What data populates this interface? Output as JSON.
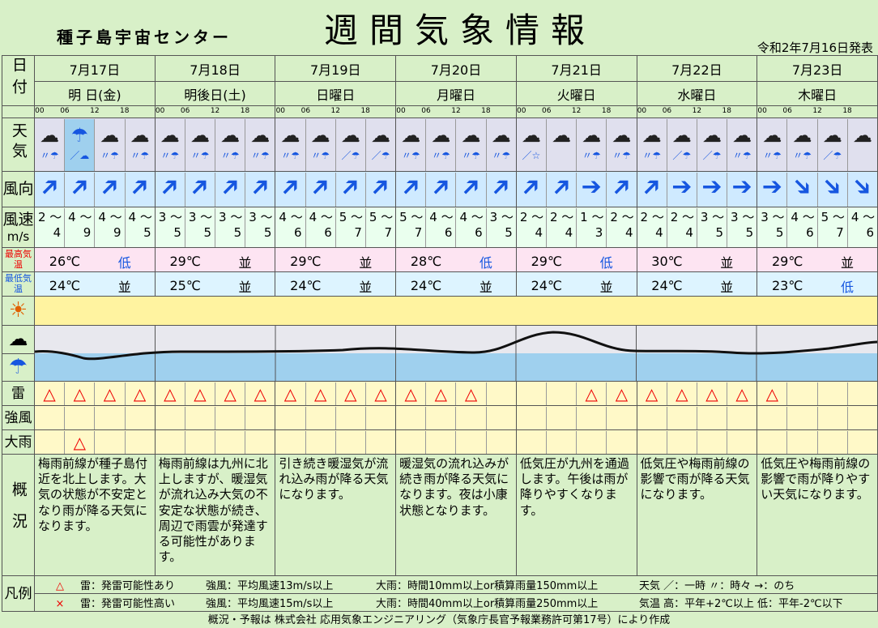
{
  "header": {
    "center": "種子島宇宙センター",
    "title": "週間気象情報",
    "issued": "令和2年7月16日発表"
  },
  "row_labels": {
    "date": "日付",
    "weather": "天気",
    "wind_dir": "風向",
    "wind_speed": "風速",
    "wind_unit": "m/s",
    "tmax": "最高気温",
    "tmin": "最低気温",
    "thunder": "雷",
    "strong_wind": "強風",
    "heavy_rain": "大雨",
    "summary": "概況",
    "legend": "凡例"
  },
  "ticks": [
    "00",
    "06",
    "12",
    "18"
  ],
  "days": [
    {
      "date": "7月17日",
      "dow": "明 日(金)",
      "weather": [
        "cloud",
        "umbrella",
        "cloud",
        "cloud"
      ],
      "sub": [
        "〃☂",
        "／☁",
        "〃☂",
        "〃☂"
      ],
      "dirs": [
        "NE",
        "NE",
        "NE",
        "NE"
      ],
      "speeds": [
        [
          "2",
          "4"
        ],
        [
          "4",
          "9"
        ],
        [
          "4",
          "9"
        ],
        [
          "4",
          "5"
        ]
      ],
      "tmax": "26℃",
      "tmax_r": "低",
      "tmin": "24℃",
      "tmin_r": "並",
      "thunder": [
        "△",
        "△",
        "△",
        "△"
      ],
      "strong": [
        "",
        "",
        "",
        ""
      ],
      "heavy": [
        "",
        "△",
        "",
        ""
      ],
      "summary": "梅雨前線が種子島付近を北上します。大気の状態が不安定となり雨が降る天気になります。"
    },
    {
      "date": "7月18日",
      "dow": "明後日(土)",
      "weather": [
        "cloud",
        "cloud",
        "cloud",
        "cloud"
      ],
      "sub": [
        "〃☂",
        "〃☂",
        "〃☂",
        "〃☂"
      ],
      "dirs": [
        "NE",
        "NE",
        "NE",
        "NE"
      ],
      "speeds": [
        [
          "3",
          "5"
        ],
        [
          "3",
          "5"
        ],
        [
          "3",
          "5"
        ],
        [
          "3",
          "5"
        ]
      ],
      "tmax": "29℃",
      "tmax_r": "並",
      "tmin": "25℃",
      "tmin_r": "並",
      "thunder": [
        "△",
        "△",
        "△",
        "△"
      ],
      "strong": [
        "",
        "",
        "",
        ""
      ],
      "heavy": [
        "",
        "",
        "",
        ""
      ],
      "summary": "梅雨前線は九州に北上しますが、暖湿気が流れ込み大気の不安定な状態が続き、周辺で雨雲が発達する可能性があります。"
    },
    {
      "date": "7月19日",
      "dow": "日曜日",
      "weather": [
        "cloud",
        "cloud",
        "cloud",
        "cloud"
      ],
      "sub": [
        "〃☂",
        "〃☂",
        "／☂",
        "／☂"
      ],
      "dirs": [
        "NE",
        "NE",
        "NE",
        "NE"
      ],
      "speeds": [
        [
          "4",
          "6"
        ],
        [
          "4",
          "6"
        ],
        [
          "5",
          "7"
        ],
        [
          "5",
          "7"
        ]
      ],
      "tmax": "29℃",
      "tmax_r": "並",
      "tmin": "24℃",
      "tmin_r": "並",
      "thunder": [
        "△",
        "△",
        "△",
        "△"
      ],
      "strong": [
        "",
        "",
        "",
        ""
      ],
      "heavy": [
        "",
        "",
        "",
        ""
      ],
      "summary": "引き続き暖湿気が流れ込み雨が降る天気になります。"
    },
    {
      "date": "7月20日",
      "dow": "月曜日",
      "weather": [
        "cloud",
        "cloud",
        "cloud",
        "cloud"
      ],
      "sub": [
        "〃☂",
        "〃☂",
        "〃☂",
        "〃☂"
      ],
      "dirs": [
        "NE",
        "NE",
        "NE",
        "NE"
      ],
      "speeds": [
        [
          "5",
          "7"
        ],
        [
          "4",
          "6"
        ],
        [
          "4",
          "6"
        ],
        [
          "3",
          "5"
        ]
      ],
      "tmax": "28℃",
      "tmax_r": "低",
      "tmin": "24℃",
      "tmin_r": "並",
      "thunder": [
        "△",
        "△",
        "△",
        ""
      ],
      "strong": [
        "",
        "",
        "",
        ""
      ],
      "heavy": [
        "",
        "",
        "",
        ""
      ],
      "summary": "暖湿気の流れ込みが続き雨が降る天気になります。夜は小康状態となります。"
    },
    {
      "date": "7月21日",
      "dow": "火曜日",
      "weather": [
        "cloud",
        "cloud",
        "cloud",
        "cloud"
      ],
      "sub": [
        "／☆",
        "",
        "〃☂",
        "〃☂"
      ],
      "dirs": [
        "NE",
        "NE",
        "E",
        "NE"
      ],
      "speeds": [
        [
          "2",
          "4"
        ],
        [
          "2",
          "4"
        ],
        [
          "1",
          "3"
        ],
        [
          "2",
          "4"
        ]
      ],
      "tmax": "29℃",
      "tmax_r": "低",
      "tmin": "24℃",
      "tmin_r": "並",
      "thunder": [
        "",
        "",
        "△",
        "△"
      ],
      "strong": [
        "",
        "",
        "",
        ""
      ],
      "heavy": [
        "",
        "",
        "",
        ""
      ],
      "summary": "低気圧が九州を通過します。午後は雨が降りやすくなります。"
    },
    {
      "date": "7月22日",
      "dow": "水曜日",
      "weather": [
        "cloud",
        "cloud",
        "cloud",
        "cloud"
      ],
      "sub": [
        "〃☂",
        "／☂",
        "／☂",
        "〃☂"
      ],
      "dirs": [
        "NE",
        "E",
        "E",
        "E"
      ],
      "speeds": [
        [
          "2",
          "4"
        ],
        [
          "2",
          "4"
        ],
        [
          "3",
          "5"
        ],
        [
          "3",
          "5"
        ]
      ],
      "tmax": "30℃",
      "tmax_r": "並",
      "tmin": "24℃",
      "tmin_r": "並",
      "thunder": [
        "△",
        "△",
        "△",
        "△"
      ],
      "strong": [
        "",
        "",
        "",
        ""
      ],
      "heavy": [
        "",
        "",
        "",
        ""
      ],
      "summary": "低気圧や梅雨前線の影響で雨が降る天気になります。"
    },
    {
      "date": "7月23日",
      "dow": "木曜日",
      "weather": [
        "cloud",
        "cloud",
        "cloud",
        "cloud"
      ],
      "sub": [
        "〃☂",
        "〃☂",
        "／☂",
        "",
        ""
      ],
      "dirs": [
        "E",
        "SE",
        "SE",
        "SE"
      ],
      "speeds": [
        [
          "3",
          "5"
        ],
        [
          "4",
          "6"
        ],
        [
          "5",
          "7"
        ],
        [
          "4",
          "6"
        ]
      ],
      "tmax": "29℃",
      "tmax_r": "並",
      "tmin": "23℃",
      "tmin_r": "低",
      "thunder": [
        "△",
        "",
        "",
        ""
      ],
      "strong": [
        "",
        "",
        "",
        ""
      ],
      "heavy": [
        "",
        "",
        "",
        ""
      ],
      "summary": "低気圧や梅雨前線の影響で雨が降りやすい天気になります。"
    }
  ],
  "legend": {
    "row1": {
      "mark": "△",
      "thunder": "雷：発雷可能性あり",
      "wind": "強風：平均風速13m/s以上",
      "rain": "大雨：時間10mm以上or積算雨量150mm以上",
      "weather": "天気 ／：一時 〃：時々 →：のち"
    },
    "row2": {
      "mark": "×",
      "thunder": "雷：発雷可能性高い",
      "wind": "強風：平均風速15m/s以上",
      "rain": "大雨：時間40mm以上or積算雨量250mm以上",
      "temp": "気温 高：平年+2℃以上 低：平年-2℃以下"
    }
  },
  "footer": "概況・予報は 株式会社 応用気象エンジニアリング（気象庁長官予報業務許可第17号）により作成"
}
